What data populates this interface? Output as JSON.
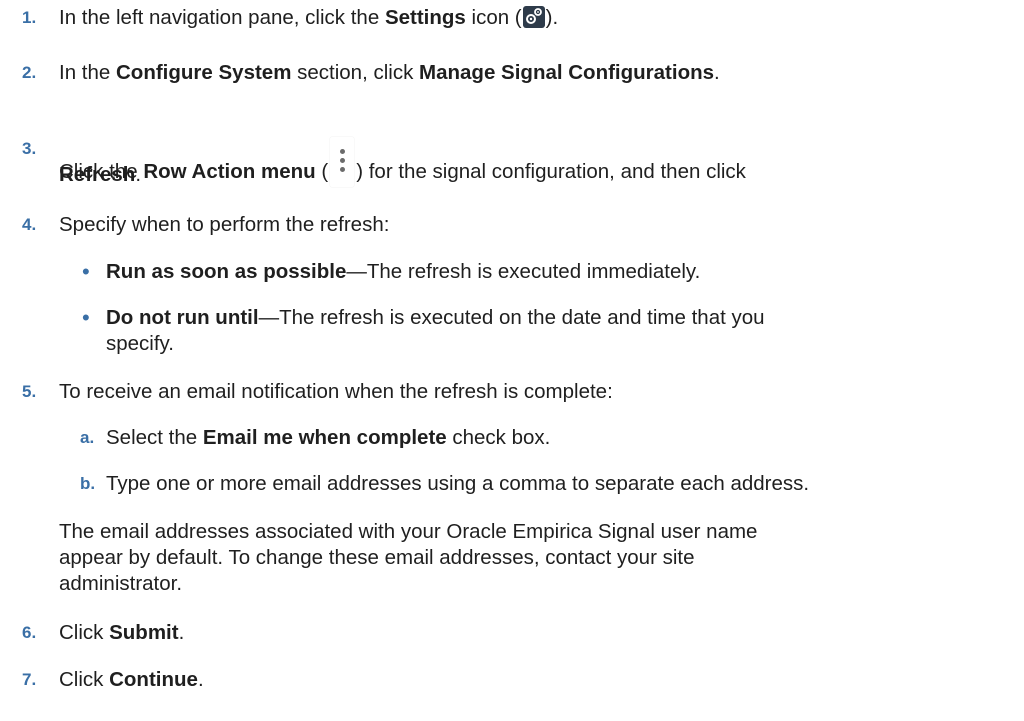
{
  "steps": {
    "s1": {
      "num": "1.",
      "pre": "In the left navigation pane, click the ",
      "bold": "Settings",
      "post1": " icon (",
      "icon": "gear-icon",
      "post2": ")."
    },
    "s2": {
      "num": "2.",
      "pre": "In the ",
      "bold1": "Configure System",
      "mid": " section, click ",
      "bold2": "Manage Signal Configurations",
      "post": "."
    },
    "s3": {
      "num": "3.",
      "pre": "Click the ",
      "bold1": "Row Action menu",
      "mid1": " (",
      "icon": "kebab-menu-icon",
      "mid2": ") for the signal configuration, and then click",
      "bold2": "Refresh",
      "post": "."
    },
    "s4": {
      "num": "4.",
      "text": "Specify when to perform the refresh:"
    },
    "s4_bullets": [
      {
        "bold": "Run as soon as possible",
        "text": "—The refresh is executed immediately."
      },
      {
        "bold": "Do not run until",
        "text": "—The refresh is executed on the date and time that you",
        "text2": "specify."
      }
    ],
    "s5": {
      "num": "5.",
      "text": "To receive an email notification when the refresh is complete:"
    },
    "s5_subs": [
      {
        "label": "a.",
        "pre": "Select the ",
        "bold": "Email me when complete",
        "post": " check box."
      },
      {
        "label": "b.",
        "text": "Type one or more email addresses using a comma to separate each address."
      }
    ],
    "s5_note": [
      "The email addresses associated with your Oracle Empirica Signal user name",
      "appear by default. To change these email addresses, contact your site",
      "administrator."
    ],
    "s6": {
      "num": "6.",
      "pre": "Click ",
      "bold": "Submit",
      "post": "."
    },
    "s7": {
      "num": "7.",
      "pre": "Click ",
      "bold": "Continue",
      "post": "."
    }
  }
}
